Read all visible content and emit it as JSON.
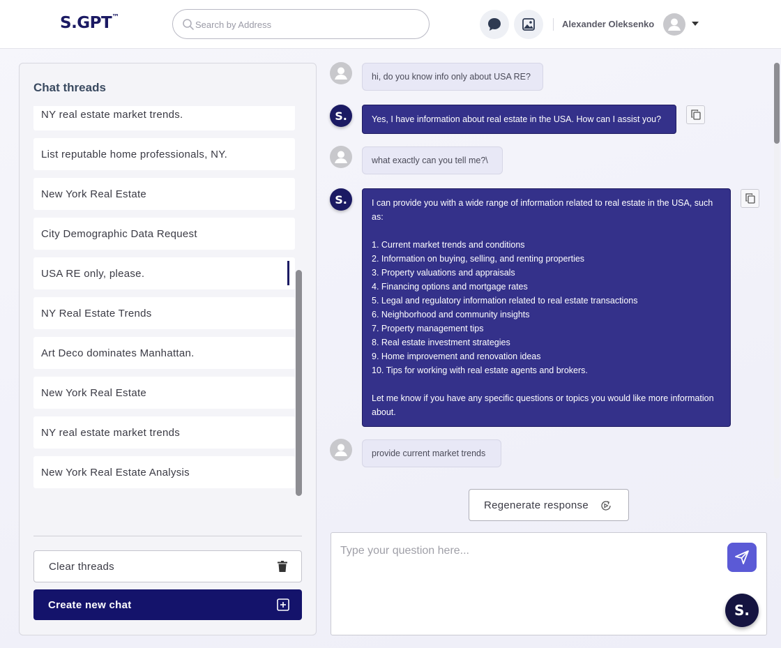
{
  "header": {
    "logo": "S.GPT",
    "logo_mark": "™",
    "search_placeholder": "Search by Address",
    "user_name": "Alexander Oleksenko"
  },
  "sidebar": {
    "title": "Chat threads",
    "threads": [
      "NY real estate market trends.",
      "List reputable home professionals, NY.",
      "New York Real Estate",
      "City Demographic Data Request",
      "USA RE only, please.",
      "NY Real Estate Trends",
      "Art Deco dominates Manhattan.",
      "New York Real Estate",
      "NY real estate market trends",
      "New York Real Estate Analysis"
    ],
    "active_index": 4,
    "clear_label": "Clear threads",
    "new_chat_label": "Create new chat"
  },
  "chat": {
    "bot_avatar": "S.",
    "messages": [
      {
        "role": "user",
        "text": "hi, do you know info only about USA RE?"
      },
      {
        "role": "bot",
        "text": "Yes, I have information about real estate in the USA. How can I assist you?"
      },
      {
        "role": "user",
        "text": "what exactly can you tell me?\\"
      },
      {
        "role": "bot",
        "text": "I can provide you with a wide range of information related to real estate in the USA, such as:\n\n1. Current market trends and conditions\n2. Information on buying, selling, and renting properties\n3. Property valuations and appraisals\n4. Financing options and mortgage rates\n5. Legal and regulatory information related to real estate transactions\n6. Neighborhood and community insights\n7. Property management tips\n8. Real estate investment strategies\n9. Home improvement and renovation ideas\n10. Tips for working with real estate agents and brokers.\n\nLet me know if you have any specific questions or topics you would like more information about."
      },
      {
        "role": "user",
        "text": "provide current market trends"
      }
    ],
    "regenerate_label": "Regenerate response",
    "input_placeholder": "Type your question here...",
    "fab_label": "S."
  },
  "colors": {
    "brand": "#1b1a63",
    "bot_bubble": "#34318a",
    "send_button": "#5b5ad6"
  }
}
